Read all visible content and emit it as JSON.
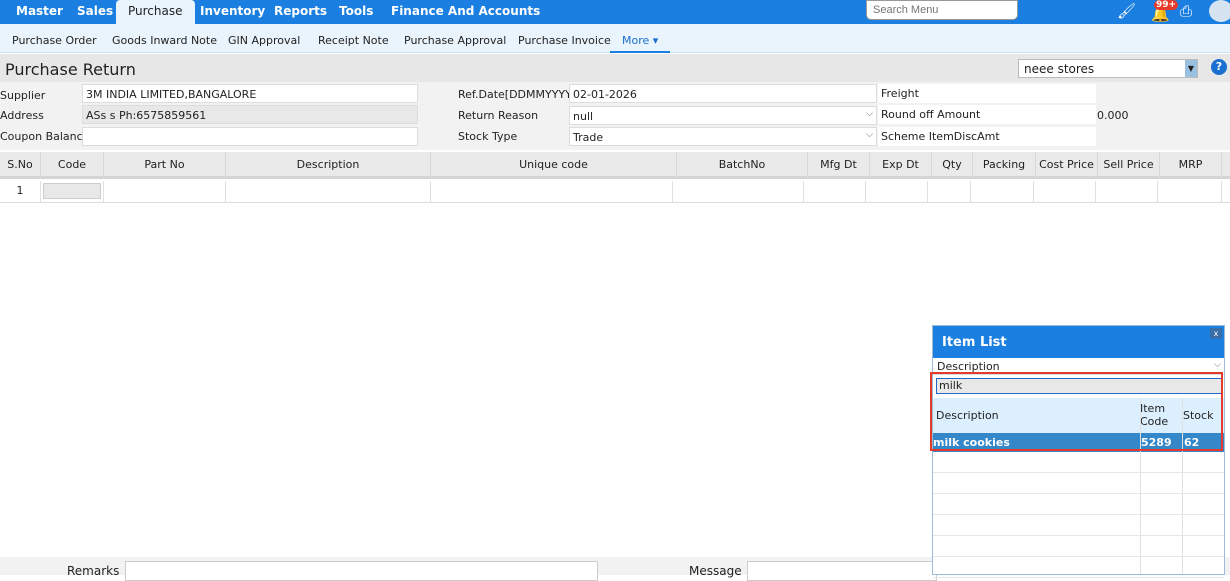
{
  "topnav": {
    "items": [
      "Master",
      "Sales",
      "Purchase",
      "Inventory",
      "Reports",
      "Tools",
      "Finance And Accounts"
    ],
    "active": "Purchase",
    "search_placeholder": "Search Menu",
    "badge": "99+"
  },
  "subnav": {
    "items": [
      "Purchase Order",
      "Goods Inward Note",
      "GIN Approval",
      "Receipt Note",
      "Purchase Approval",
      "Purchase Invoice"
    ],
    "more": "More"
  },
  "page": {
    "title": "Purchase Return",
    "store": "neee stores",
    "help": "?"
  },
  "form": {
    "supplier_label": "Supplier",
    "supplier": "3M INDIA LIMITED,BANGALORE",
    "address_label": "Address",
    "address": "ASs s Ph:6575859561",
    "coupon_label": "Coupon Balance",
    "coupon": "",
    "refdate_label": "Ref.Date[DDMMYYYY]",
    "refdate": "02-01-2026",
    "reason_label": "Return Reason",
    "reason": "null",
    "stock_type_label": "Stock Type",
    "stock_type": "Trade",
    "freight_label": "Freight",
    "freight": "",
    "roundoff_label": "Round off Amount",
    "roundoff": "0.000",
    "scheme_label": "Scheme ItemDiscAmt",
    "scheme": ""
  },
  "table": {
    "columns": [
      "S.No",
      "Code",
      "Part No",
      "Description",
      "Unique code",
      "BatchNo",
      "Mfg Dt",
      "Exp Dt",
      "Qty",
      "Packing",
      "Cost Price",
      "Sell Price",
      "MRP"
    ],
    "rows": [
      [
        "1",
        "",
        "",
        "",
        "",
        "",
        "",
        "",
        "",
        "",
        "",
        "",
        ""
      ]
    ]
  },
  "footer": {
    "remarks_label": "Remarks",
    "message_label": "Message"
  },
  "item_list": {
    "title": "Item List",
    "close": "x",
    "search_by": "Description",
    "query": "milk",
    "columns": [
      "Description",
      "Item Code",
      "Stock"
    ],
    "rows": [
      {
        "description": "milk cookies",
        "code": "5289",
        "stock": "62"
      }
    ]
  }
}
